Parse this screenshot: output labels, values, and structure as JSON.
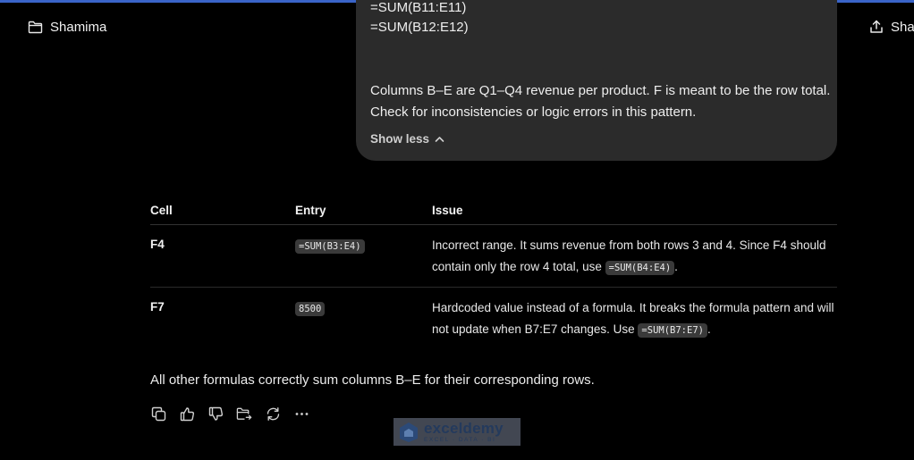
{
  "header": {
    "project_name": "Shamima",
    "share_label": "Share"
  },
  "prompt": {
    "formula_lines": [
      "=SUM(B11:E11)",
      "=SUM(B12:E12)"
    ],
    "description": "Columns B–E are Q1–Q4 revenue per product. F is meant to be the row total. Check for inconsistencies or logic errors in this pattern.",
    "show_less_label": "Show less"
  },
  "response": {
    "table": {
      "headers": [
        "Cell",
        "Entry",
        "Issue"
      ],
      "rows": [
        {
          "cell": "F4",
          "entry": "=SUM(B3:E4)",
          "issue_text": "Incorrect range. It sums revenue from both rows 3 and 4. Since F4 should contain only the row 4 total, use ",
          "issue_code": "=SUM(B4:E4)",
          "issue_end": "."
        },
        {
          "cell": "F7",
          "entry": "8500",
          "issue_text": "Hardcoded value instead of a formula. It breaks the formula pattern and will not update when B7:E7 changes. Use ",
          "issue_code": "=SUM(B7:E7)",
          "issue_end": "."
        }
      ]
    },
    "summary": "All other formulas correctly sum columns B–E for their corresponding rows."
  },
  "actions": {
    "icons": [
      "copy-icon",
      "thumbs-up-icon",
      "thumbs-down-icon",
      "share-to-folder-icon",
      "regenerate-icon",
      "more-icon"
    ]
  },
  "watermark": {
    "name": "exceldemy",
    "tagline": "EXCEL · DATA · BI"
  },
  "colors": {
    "background": "#000000",
    "bubble": "#2b2b2b",
    "accent_bar": "#3a64c8",
    "code_bg": "#3a3a3a"
  }
}
